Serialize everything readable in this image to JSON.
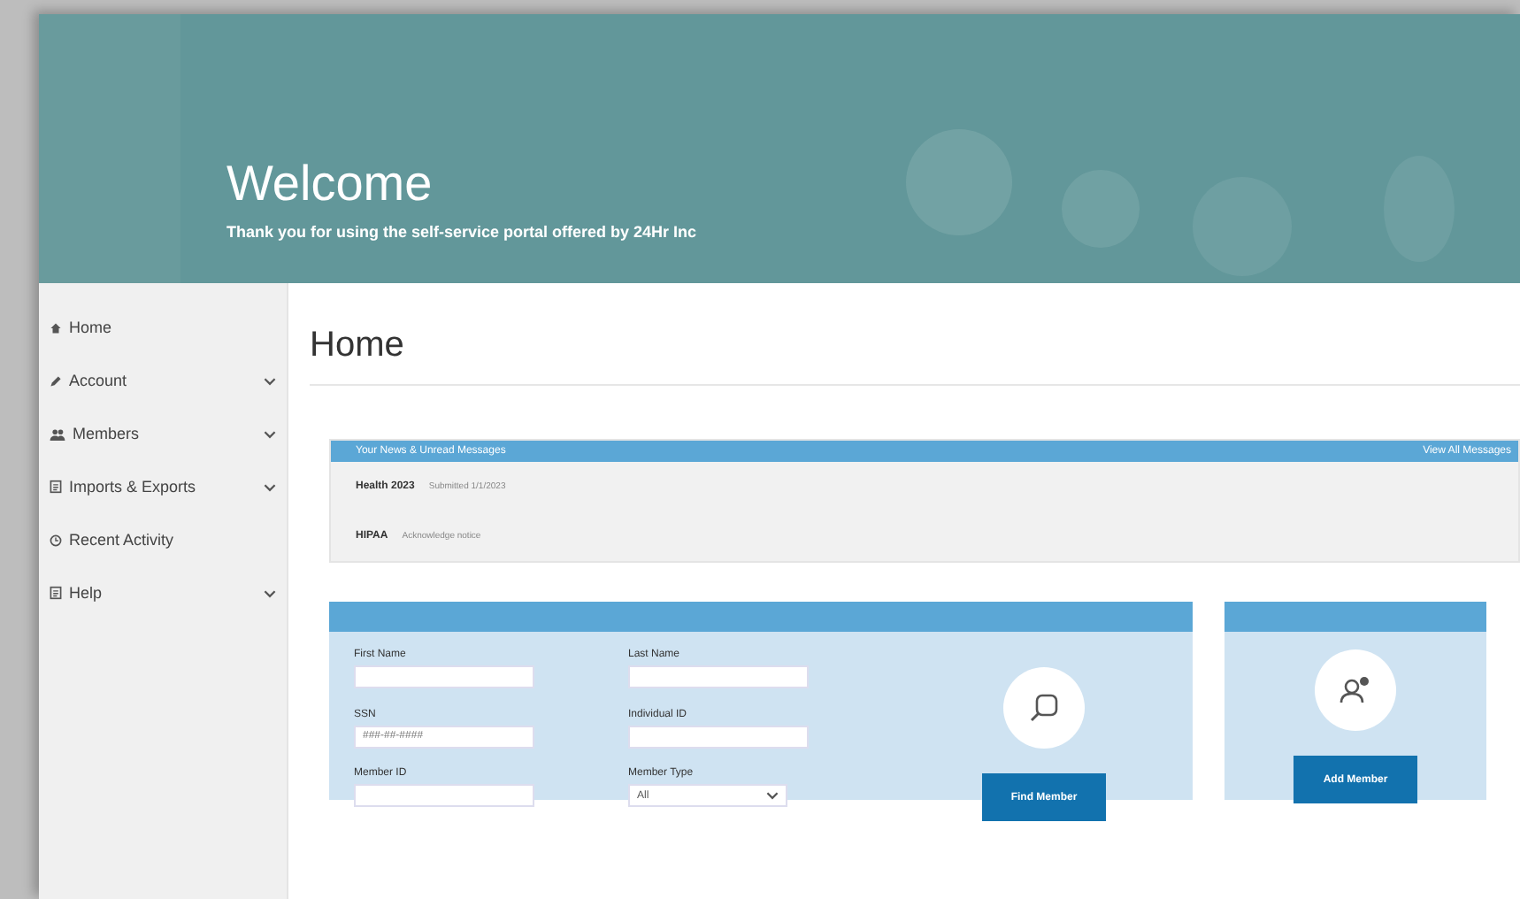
{
  "header": {
    "title": "Welcome",
    "subtitle": "Thank you for using the self-service portal offered by 24Hr Inc"
  },
  "sidebar": {
    "items": [
      {
        "label": "Home",
        "has_children": false,
        "selected": false
      },
      {
        "label": "Account",
        "has_children": true,
        "selected": false
      },
      {
        "label": "Members",
        "has_children": true,
        "selected": false
      },
      {
        "label": "Imports & Exports",
        "has_children": true,
        "selected": false
      },
      {
        "label": "Recent Activity",
        "has_children": false,
        "selected": false
      },
      {
        "label": "Help",
        "has_children": true,
        "selected": false
      }
    ]
  },
  "page_title": "Home",
  "news": {
    "title": "Your News & Unread Messages",
    "link": "View All Messages",
    "items": [
      {
        "label": "Health 2023",
        "note": "Submitted 1/1/2023"
      },
      {
        "label": "HIPAA",
        "note": "Acknowledge notice"
      }
    ]
  },
  "find_member": {
    "fields": [
      {
        "label": "First Name",
        "kind": "text"
      },
      {
        "label": "Last Name",
        "kind": "text"
      },
      {
        "label": "SSN",
        "kind": "text",
        "placeholder": "###-##-####"
      },
      {
        "label": "Individual ID",
        "kind": "text"
      },
      {
        "label": "Member ID",
        "kind": "text"
      },
      {
        "label": "Member Type",
        "kind": "select",
        "value": "All"
      }
    ],
    "button": "Find Member"
  },
  "add_member": {
    "button": "Add Member"
  }
}
